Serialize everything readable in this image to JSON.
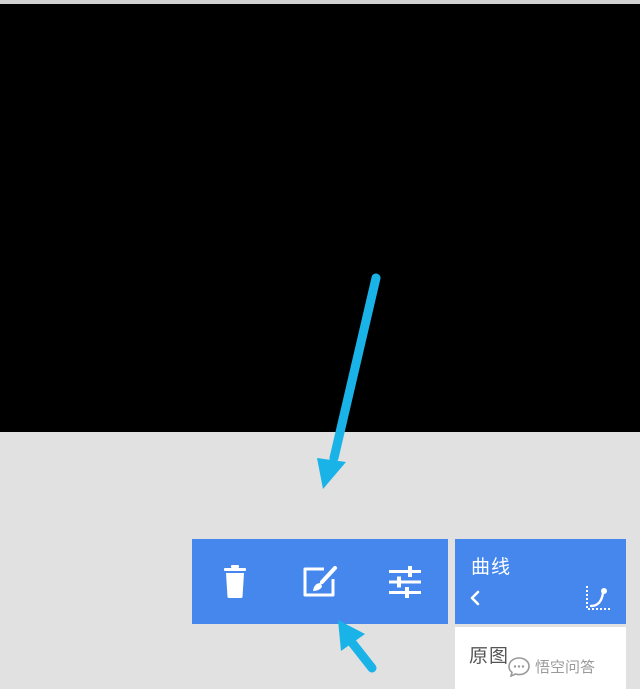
{
  "colors": {
    "accent": "#4687ee",
    "annotation_arrow": "#1ab3e8",
    "canvas": "#000000",
    "workspace": "#e1e1e1"
  },
  "toolbar": {
    "items": [
      {
        "icon": "trash-icon"
      },
      {
        "icon": "edit-brush-icon"
      },
      {
        "icon": "sliders-icon"
      }
    ]
  },
  "curves_panel": {
    "title": "曲线",
    "back_icon": "chevron-left-icon",
    "tool_icon": "curve-tool-icon"
  },
  "presets": {
    "items": [
      "原图"
    ]
  },
  "watermark": {
    "text": "悟空问答"
  }
}
